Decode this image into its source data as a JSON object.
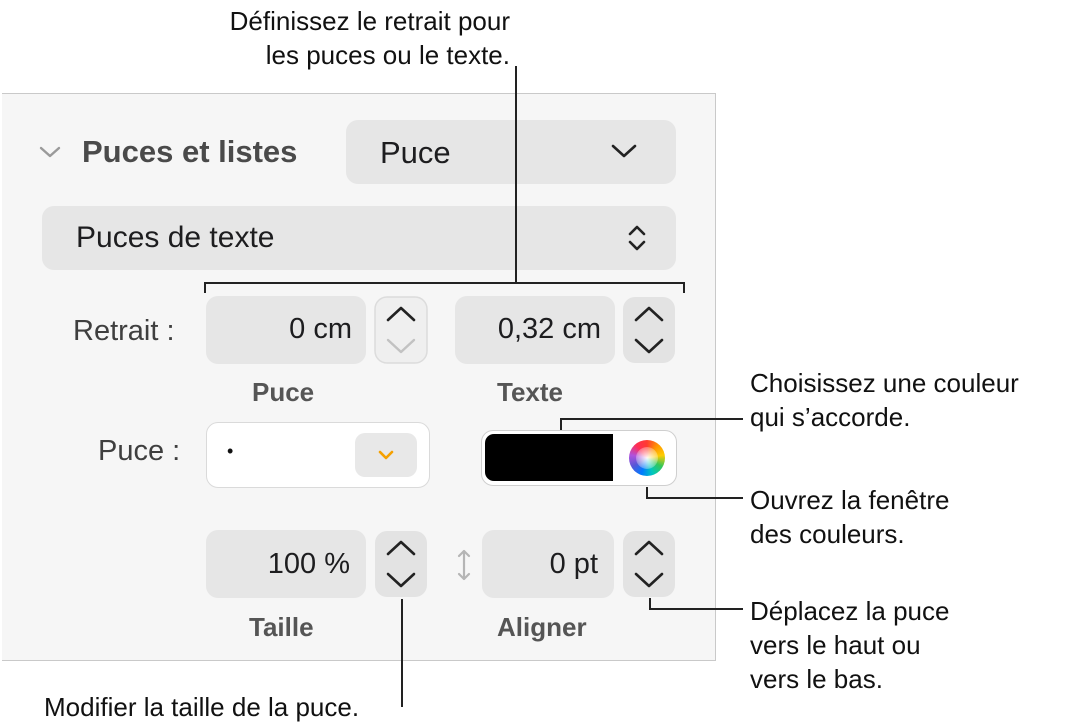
{
  "callouts": {
    "indent": [
      "Définissez le retrait pour",
      "les puces ou le texte."
    ],
    "color": [
      "Choisissez une couleur",
      "qui s’accorde."
    ],
    "colorwindow": [
      "Ouvrez la fenêtre",
      "des couleurs."
    ],
    "move": [
      "Déplacez la puce",
      "vers le haut ou",
      "vers le bas."
    ],
    "size": "Modifier la taille de la puce."
  },
  "section": {
    "title": "Puces et listes",
    "style_value": "Puce",
    "type_value": "Puces de texte"
  },
  "indent": {
    "label": "Retrait :",
    "bullet_value": "0 cm",
    "bullet_caption": "Puce",
    "text_value": "0,32 cm",
    "text_caption": "Texte"
  },
  "bullet": {
    "label": "Puce :",
    "char": "•",
    "color": "#000000"
  },
  "size": {
    "value": "100 %",
    "caption": "Taille"
  },
  "align": {
    "value": "0 pt",
    "caption": "Aligner"
  },
  "colors": {
    "panel_bg": "#f6f6f6",
    "field_bg": "#e6e6e6",
    "accent_orange": "#f5a000"
  }
}
